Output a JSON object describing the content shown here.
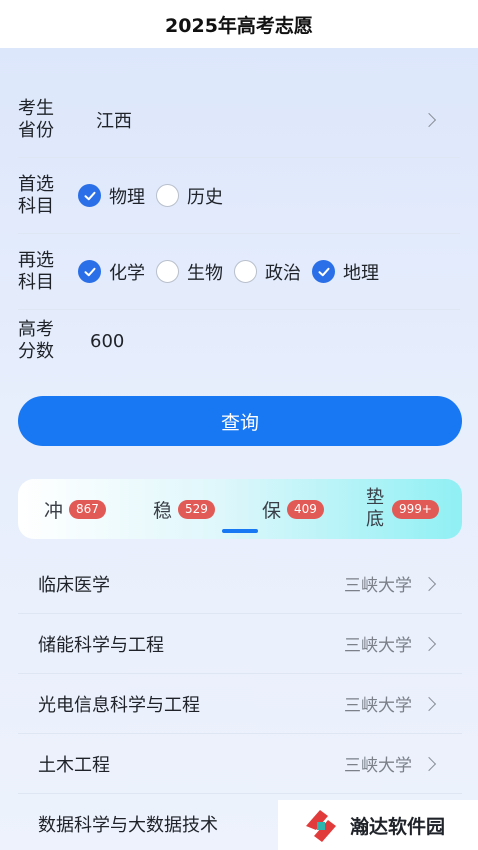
{
  "header": {
    "title": "2025年高考志愿"
  },
  "form": {
    "province": {
      "label": "考生省份",
      "value": "江西"
    },
    "first_subject": {
      "label": "首选科目",
      "options": [
        {
          "label": "物理",
          "checked": true
        },
        {
          "label": "历史",
          "checked": false
        }
      ]
    },
    "second_subject": {
      "label": "再选科目",
      "options": [
        {
          "label": "化学",
          "checked": true
        },
        {
          "label": "生物",
          "checked": false
        },
        {
          "label": "政治",
          "checked": false
        },
        {
          "label": "地理",
          "checked": true
        }
      ]
    },
    "score": {
      "label": "高考分数",
      "value": "600"
    }
  },
  "query_button": {
    "label": "查询"
  },
  "tabs": [
    {
      "name": "冲",
      "count": "867"
    },
    {
      "name": "稳",
      "count": "529"
    },
    {
      "name": "保",
      "count": "409",
      "active": true
    },
    {
      "name": "垫底",
      "count": "999+"
    }
  ],
  "results": [
    {
      "major": "临床医学",
      "school": "三峡大学"
    },
    {
      "major": "储能科学与工程",
      "school": "三峡大学"
    },
    {
      "major": "光电信息科学与工程",
      "school": "三峡大学"
    },
    {
      "major": "土木工程",
      "school": "三峡大学"
    },
    {
      "major": "数据科学与大数据技术",
      "school": ""
    }
  ],
  "watermark": {
    "text": "瀚达软件园"
  },
  "colors": {
    "primary": "#1877f2",
    "badge": "#e25a55",
    "check": "#2a6fe8"
  }
}
